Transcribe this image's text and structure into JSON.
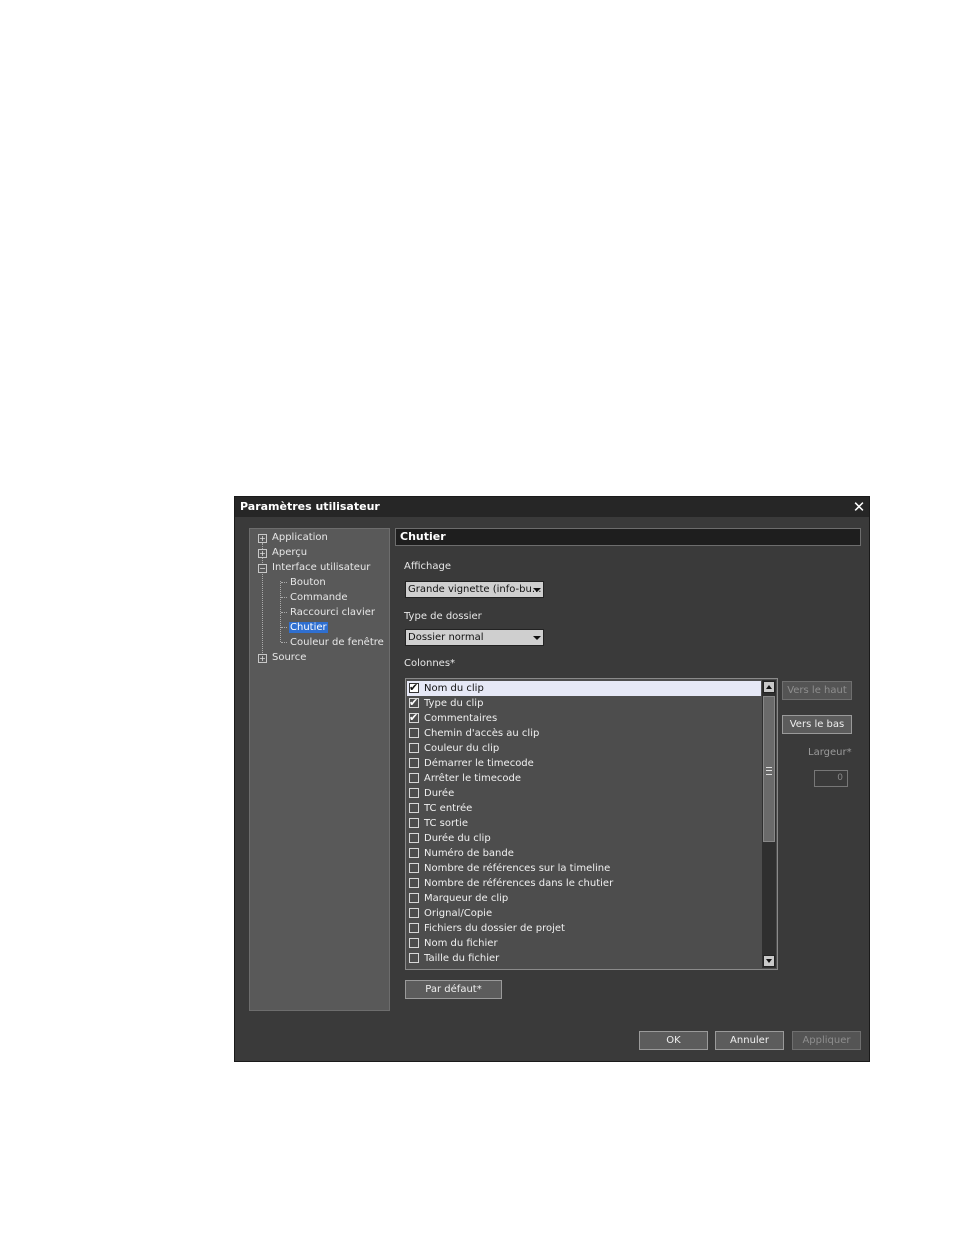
{
  "dialog": {
    "title": "Paramètres utilisateur",
    "close_icon": "close-icon"
  },
  "tree": {
    "items": [
      {
        "label": "Application",
        "expander": "+"
      },
      {
        "label": "Aperçu",
        "expander": "+"
      },
      {
        "label": "Interface utilisateur",
        "expander": "−"
      },
      {
        "label": "Bouton"
      },
      {
        "label": "Commande"
      },
      {
        "label": "Raccourci clavier"
      },
      {
        "label": "Chutier",
        "selected": true
      },
      {
        "label": "Couleur de fenêtre"
      },
      {
        "label": "Source",
        "expander": "+"
      }
    ]
  },
  "panel": {
    "header": "Chutier",
    "affichage_label": "Affichage",
    "affichage_value": "Grande vignette (info-bu...",
    "type_label": "Type de dossier",
    "type_value": "Dossier normal",
    "colonnes_label": "Colonnes*",
    "columns": [
      {
        "label": "Nom du clip",
        "checked": true,
        "selected": true
      },
      {
        "label": "Type du clip",
        "checked": true
      },
      {
        "label": "Commentaires",
        "checked": true
      },
      {
        "label": "Chemin d'accès au clip",
        "checked": false
      },
      {
        "label": "Couleur du clip",
        "checked": false
      },
      {
        "label": "Démarrer le timecode",
        "checked": false
      },
      {
        "label": "Arrêter le timecode",
        "checked": false
      },
      {
        "label": "Durée",
        "checked": false
      },
      {
        "label": "TC entrée",
        "checked": false
      },
      {
        "label": "TC sortie",
        "checked": false
      },
      {
        "label": "Durée du clip",
        "checked": false
      },
      {
        "label": "Numéro de bande",
        "checked": false
      },
      {
        "label": "Nombre de références sur la timeline",
        "checked": false
      },
      {
        "label": "Nombre de références dans le chutier",
        "checked": false
      },
      {
        "label": "Marqueur de clip",
        "checked": false
      },
      {
        "label": "Orignal/Copie",
        "checked": false
      },
      {
        "label": "Fichiers du dossier de projet",
        "checked": false
      },
      {
        "label": "Nom du fichier",
        "checked": false
      },
      {
        "label": "Taille du fichier",
        "checked": false
      }
    ],
    "vers_le_haut": "Vers le haut",
    "vers_le_bas": "Vers le bas",
    "largeur_label": "Largeur*",
    "largeur_value": "0",
    "par_defaut": "Par défaut*"
  },
  "footer": {
    "ok": "OK",
    "annuler": "Annuler",
    "appliquer": "Appliquer"
  }
}
